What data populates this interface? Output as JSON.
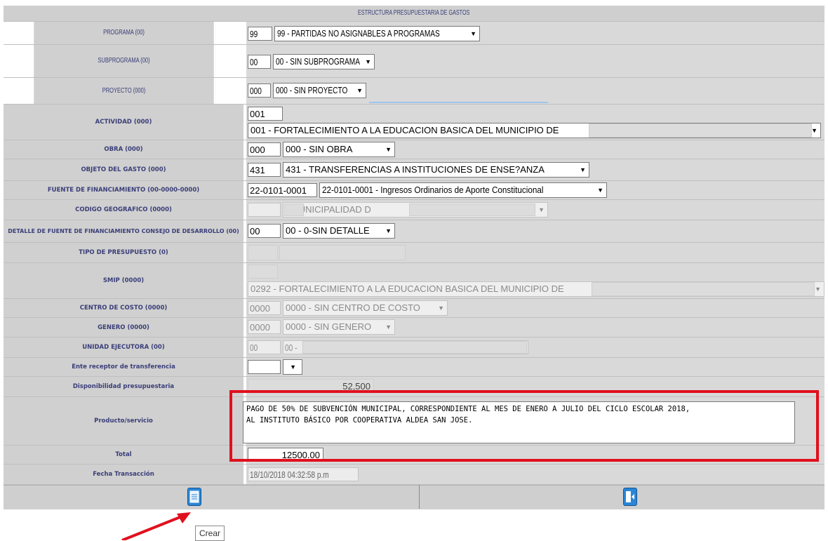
{
  "header": {
    "title": "ESTRUCTURA PRESUPUESTARIA DE GASTOS"
  },
  "rows": {
    "programa": {
      "label": "PROGRAMA (00)",
      "code": "99",
      "select": "99 - PARTIDAS NO ASIGNABLES A PROGRAMAS"
    },
    "subprograma": {
      "label": "SUBPROGRAMA (00)",
      "code": "00",
      "select": "00 - SIN SUBPROGRAMA"
    },
    "proyecto": {
      "label": "PROYECTO (000)",
      "code": "000",
      "select": "000 - SIN PROYECTO"
    },
    "actividad": {
      "label": "ACTIVIDAD (000)",
      "code": "001",
      "select": "001 - FORTALECIMIENTO A LA EDUCACION BASICA DEL MUNICIPIO DE"
    },
    "obra": {
      "label": "OBRA (000)",
      "code": "000",
      "select": "000 - SIN OBRA"
    },
    "objeto": {
      "label": "OBJETO DEL GASTO (000)",
      "code": "431",
      "select": "431 - TRANSFERENCIAS A INSTITUCIONES DE ENSE?ANZA"
    },
    "fuente": {
      "label": "FUENTE DE FINANCIAMIENTO (00-0000-0000)",
      "code": "22-0101-0001",
      "select": "22-0101-0001 - Ingresos Ordinarios de Aporte Constitucional"
    },
    "geografico": {
      "label": "CODIGO GEOGRAFICO (0000)",
      "select": "- MUNICIPALIDAD D"
    },
    "detalle": {
      "label": "DETALLE DE FUENTE DE FINANCIAMIENTO CONSEJO DE DESARROLLO (00)",
      "code": "00",
      "select": "00 - 0-SIN DETALLE"
    },
    "tipo": {
      "label": "TIPO DE PRESUPUESTO (0)"
    },
    "smip": {
      "label": "SMIP (0000)",
      "select": "0292 - FORTALECIMIENTO A LA EDUCACION BASICA DEL MUNICIPIO DE"
    },
    "centro": {
      "label": "CENTRO DE COSTO (0000)",
      "code": "0000",
      "select": "0000 - SIN CENTRO DE COSTO"
    },
    "genero": {
      "label": "GENERO (0000)",
      "code": "0000",
      "select": "0000 - SIN GENERO"
    },
    "unidad": {
      "label": "UNIDAD EJECUTORA (00)",
      "code": "00",
      "select": "00 -"
    },
    "ente": {
      "label": "Ente receptor de transferencia"
    },
    "disponibilidad": {
      "label": "Disponibilidad presupuestaria",
      "value": "52,500"
    },
    "producto": {
      "label": "Producto/servicio",
      "value": "PAGO DE 50% DE SUBVENCIÓN MUNICIPAL, CORRESPONDIENTE AL MES DE ENERO A JULIO DEL CICLO ESCOLAR 2018,\nAL INSTITUTO BÁSICO POR COOPERATIVA ALDEA SAN JOSE."
    },
    "total": {
      "label": "Total",
      "value": "12500.00"
    },
    "fecha": {
      "label": "Fecha Transacción",
      "value": "18/10/2018 04:32:58 p.m"
    }
  },
  "footer": {
    "create_tooltip": "Crear",
    "create_icon": "document-icon",
    "exit_icon": "exit-door-icon"
  },
  "colors": {
    "label_bg": "#d0d0d0",
    "label_text": "#3a3e78",
    "highlight": "#e0101d",
    "icon_blue": "#2a86d6"
  }
}
